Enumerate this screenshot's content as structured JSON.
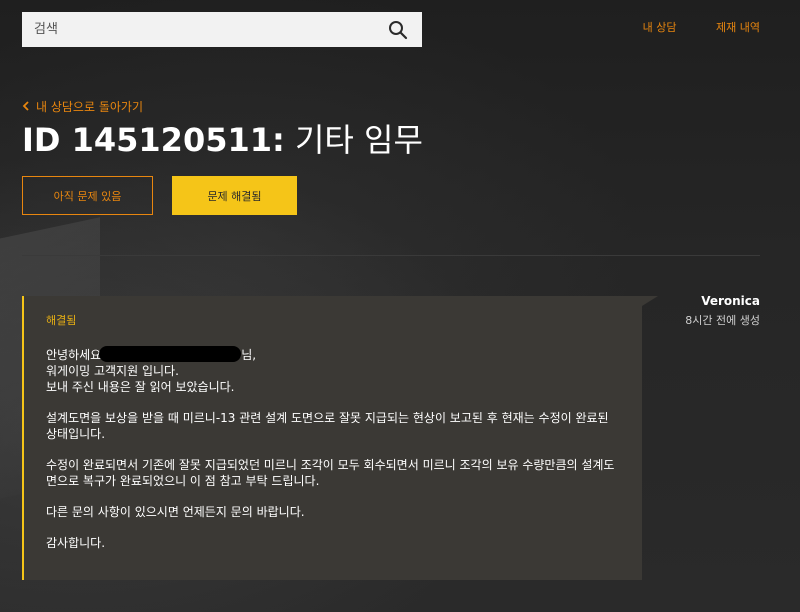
{
  "search": {
    "placeholder": "검색"
  },
  "nav": {
    "items": [
      "내 상담",
      "제재 내역"
    ]
  },
  "back_link": "내 상담으로 돌아가기",
  "ticket": {
    "id_label": "ID 145120511:",
    "subject": "기타 임무"
  },
  "actions": {
    "unresolved_label": "아직 문제 있음",
    "resolved_label": "문제 해결됨"
  },
  "message": {
    "status": "해결됨",
    "greeting_start": "안녕하세요",
    "greeting_end": "님,",
    "lines": [
      "워게이밍 고객지원 입니다.",
      "보내 주신 내용은 잘 읽어 보았습니다."
    ],
    "paragraphs": [
      "설계도면을 보상을 받을 때 미르니-13 관련 설계 도면으로 잘못 지급되는 현상이 보고된 후 현재는 수정이 완료된 상태입니다.",
      "수정이 완료되면서 기존에 잘못 지급되었던 미르니 조각이 모두 회수되면서 미르니 조각의 보유 수량만큼의 설계도면으로 복구가 완료되었으니 이 점 참고 부탁 드립니다.",
      "다른 문의 사항이 있으시면 언제든지 문의 바랍니다.",
      "감사합니다."
    ]
  },
  "author": {
    "name": "Veronica",
    "time": "8시간 전에 생성"
  },
  "colors": {
    "accent_orange": "#e8860f",
    "accent_yellow": "#f5c518",
    "message_bg": "#3b3935",
    "page_bg": "#242424"
  },
  "icons": {
    "search": "search-icon",
    "back": "chevron-left-icon"
  }
}
